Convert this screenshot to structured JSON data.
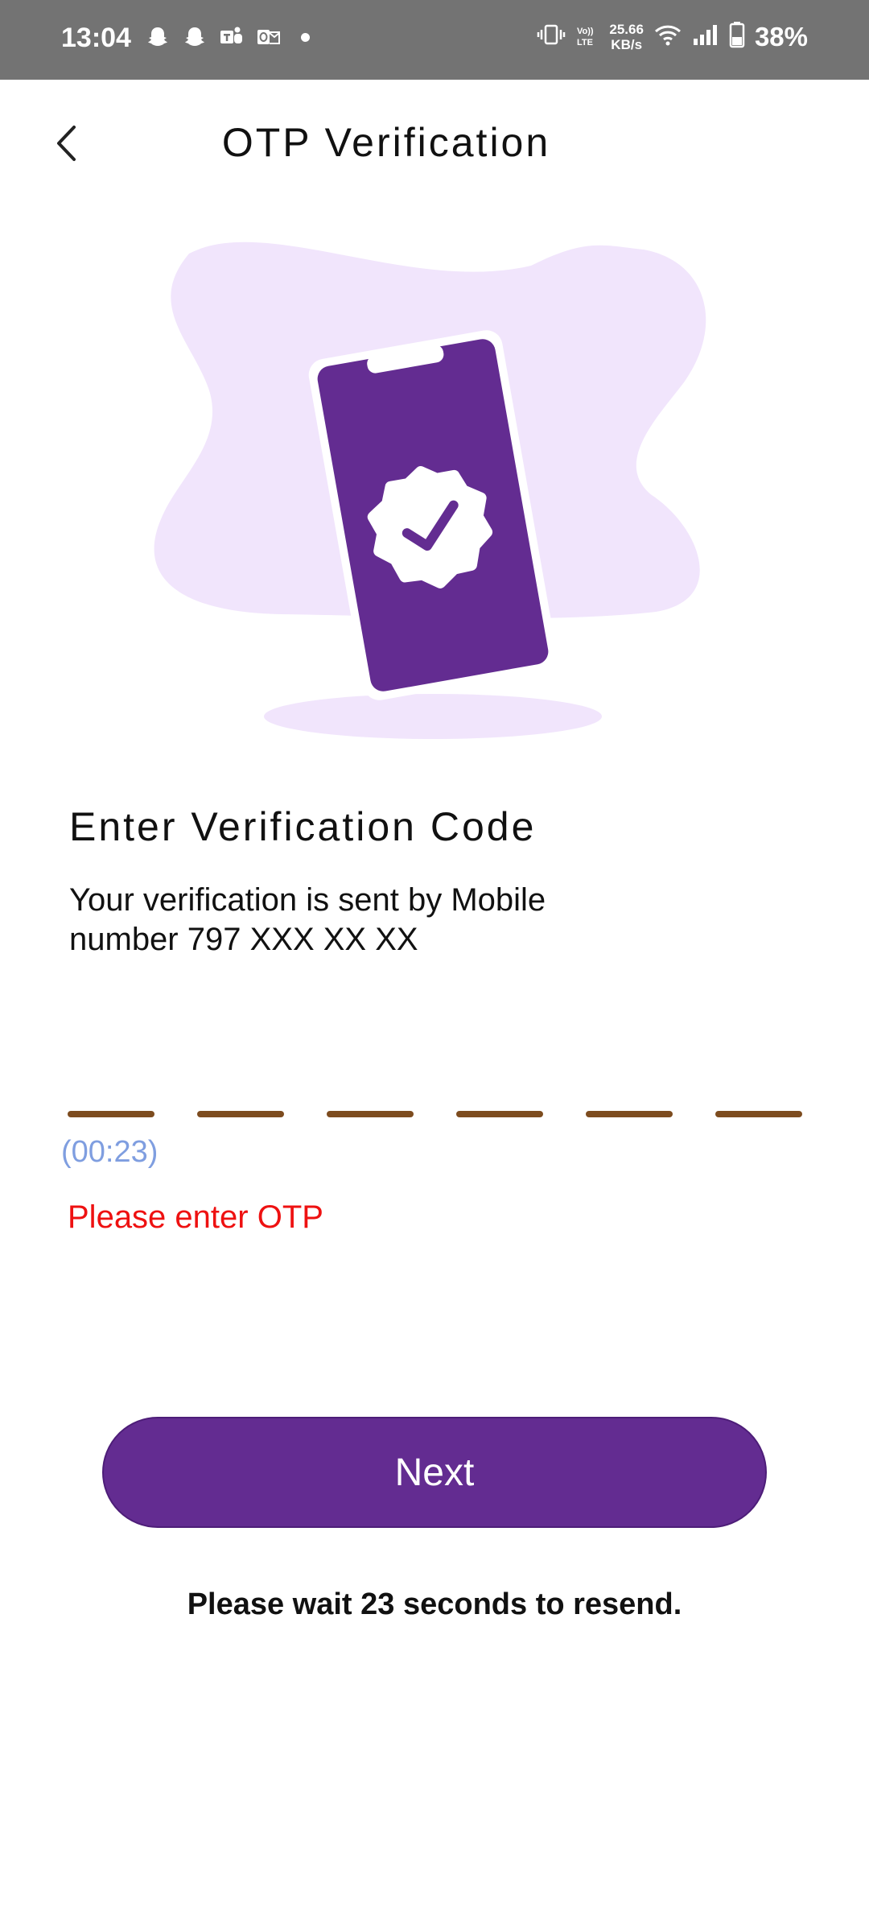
{
  "status_bar": {
    "time": "13:04",
    "network_speed_value": "25.66",
    "network_speed_unit": "KB/s",
    "volte_label": "VoLTE",
    "battery_percent": "38%"
  },
  "header": {
    "title": "OTP Verification",
    "back_icon": "chevron-left-icon"
  },
  "main": {
    "section_title": "Enter Verification Code",
    "info_text": "Your verification is sent by Mobile number 797 XXX XX XX",
    "otp_slots": [
      "",
      "",
      "",
      "",
      "",
      ""
    ],
    "timer": "(00:23)",
    "error": "Please enter OTP",
    "next_label": "Next",
    "resend_text": "Please wait 23 seconds to resend."
  },
  "colors": {
    "accent": "#632c91",
    "blob": "#f1e5fc",
    "otp_underline": "#7d4c1f",
    "timer": "#7f9ee0",
    "error": "#ee1111",
    "status_bar": "#737373"
  }
}
